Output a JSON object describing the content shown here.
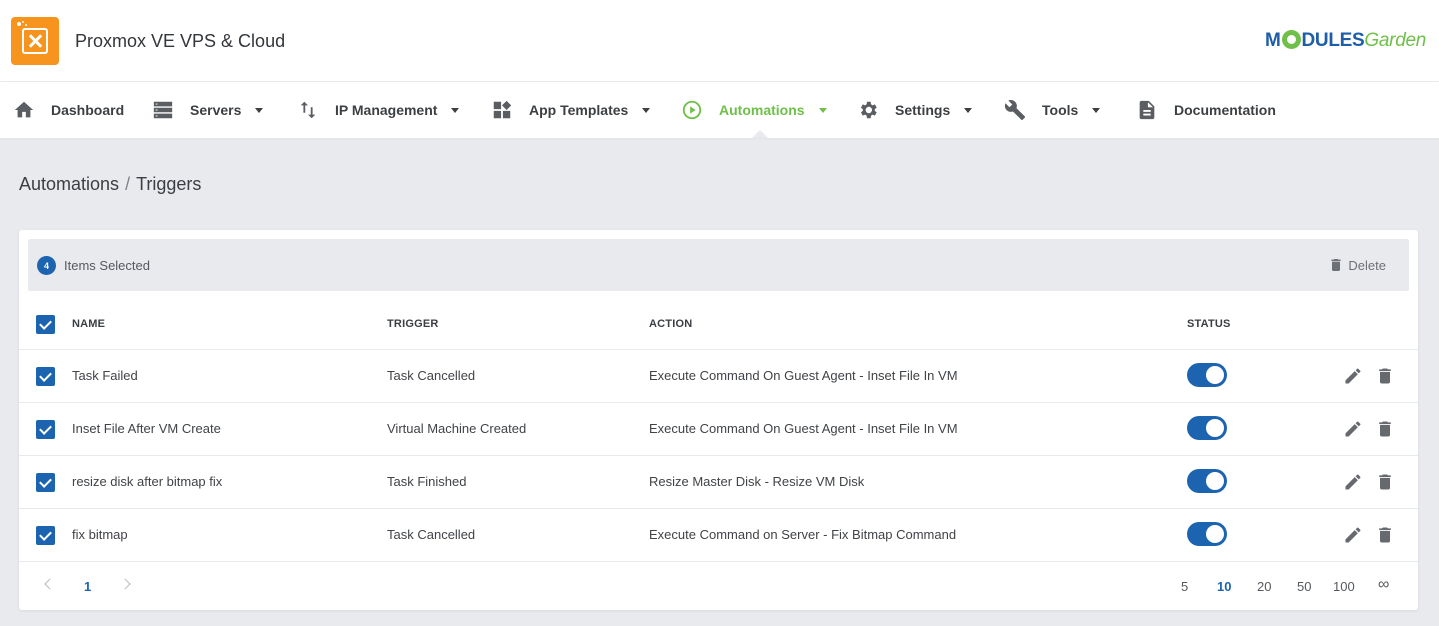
{
  "header": {
    "app_title": "Proxmox VE VPS & Cloud",
    "brand_part1": "M",
    "brand_part2": "DULES",
    "brand_part3": "Garden"
  },
  "nav": {
    "items": [
      {
        "label": "Dashboard",
        "icon": "home-icon",
        "dropdown": false
      },
      {
        "label": "Servers",
        "icon": "servers-icon",
        "dropdown": true
      },
      {
        "label": "IP Management",
        "icon": "swap-vertical-icon",
        "dropdown": true
      },
      {
        "label": "App Templates",
        "icon": "widgets-icon",
        "dropdown": true
      },
      {
        "label": "Automations",
        "icon": "play-circle-icon",
        "dropdown": true,
        "active": true
      },
      {
        "label": "Settings",
        "icon": "gear-icon",
        "dropdown": true
      },
      {
        "label": "Tools",
        "icon": "wrench-icon",
        "dropdown": true
      },
      {
        "label": "Documentation",
        "icon": "document-icon",
        "dropdown": false
      }
    ]
  },
  "breadcrumb": {
    "parent": "Automations",
    "separator": "/",
    "current": "Triggers"
  },
  "selection": {
    "count": "4",
    "text": "Items Selected",
    "delete_label": "Delete"
  },
  "table": {
    "columns": [
      "NAME",
      "TRIGGER",
      "ACTION",
      "STATUS"
    ],
    "rows": [
      {
        "name": "Task Failed",
        "trigger": "Task Cancelled",
        "action": "Execute Command On Guest Agent - Inset File In VM",
        "enabled": true
      },
      {
        "name": "Inset File After VM Create",
        "trigger": "Virtual Machine Created",
        "action": "Execute Command On Guest Agent - Inset File In VM",
        "enabled": true
      },
      {
        "name": "resize disk after bitmap fix",
        "trigger": "Task Finished",
        "action": "Resize Master Disk - Resize VM Disk",
        "enabled": true
      },
      {
        "name": "fix bitmap",
        "trigger": "Task Cancelled",
        "action": "Execute Command on Server - Fix Bitmap Command",
        "enabled": true
      }
    ]
  },
  "pagination": {
    "current_page": "1",
    "page_sizes": [
      "5",
      "10",
      "20",
      "50",
      "100",
      "∞"
    ],
    "active_size": "10"
  },
  "colors": {
    "accent": "#6fc04a",
    "primary": "#1c64b0",
    "logo": "#f7941d"
  }
}
